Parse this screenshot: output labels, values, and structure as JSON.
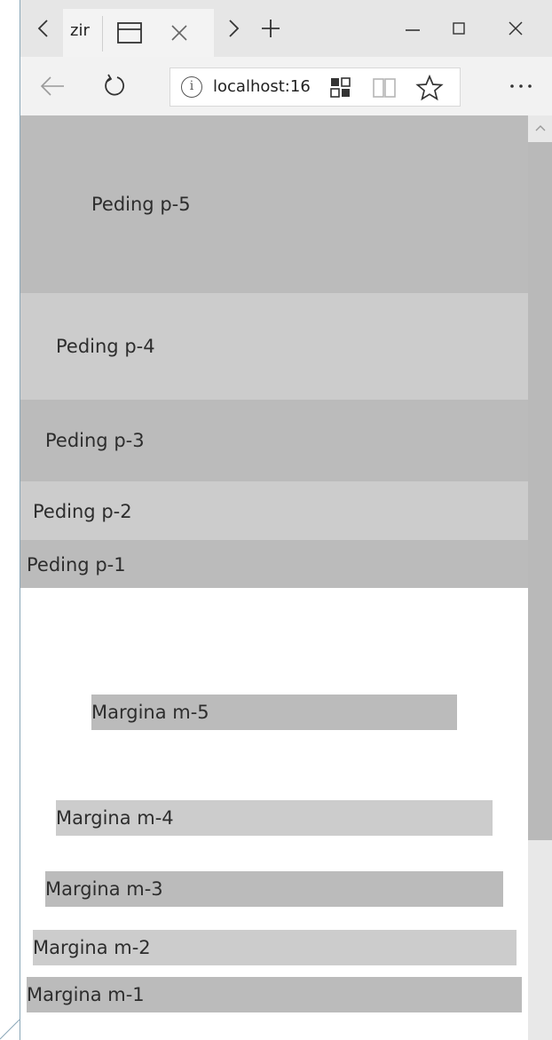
{
  "browser": {
    "tab_title": "zir",
    "url": "localhost:16",
    "controls": {
      "back_icon": "tab-back-icon",
      "forward_icon": "tab-forward-icon",
      "new_tab_icon": "plus-icon",
      "minimize_icon": "minimize-icon",
      "maximize_icon": "maximize-icon",
      "close_icon": "close-icon",
      "more_icon": "more-icon"
    }
  },
  "page": {
    "padding_boxes": [
      {
        "label": "Peding p-5"
      },
      {
        "label": "Peding p-4"
      },
      {
        "label": "Peding p-3"
      },
      {
        "label": "Peding p-2"
      },
      {
        "label": "Peding p-1"
      }
    ],
    "margin_boxes": [
      {
        "label": "Margina m-5"
      },
      {
        "label": "Margina m-4"
      },
      {
        "label": "Margina m-3"
      },
      {
        "label": "Margina m-2"
      },
      {
        "label": "Margina m-1"
      }
    ]
  },
  "colors": {
    "dark_block": "#bbbbbb",
    "light_block": "#cccccc",
    "chrome_bg": "#e6e6e6",
    "accent_blue": "#9ed6f1"
  }
}
